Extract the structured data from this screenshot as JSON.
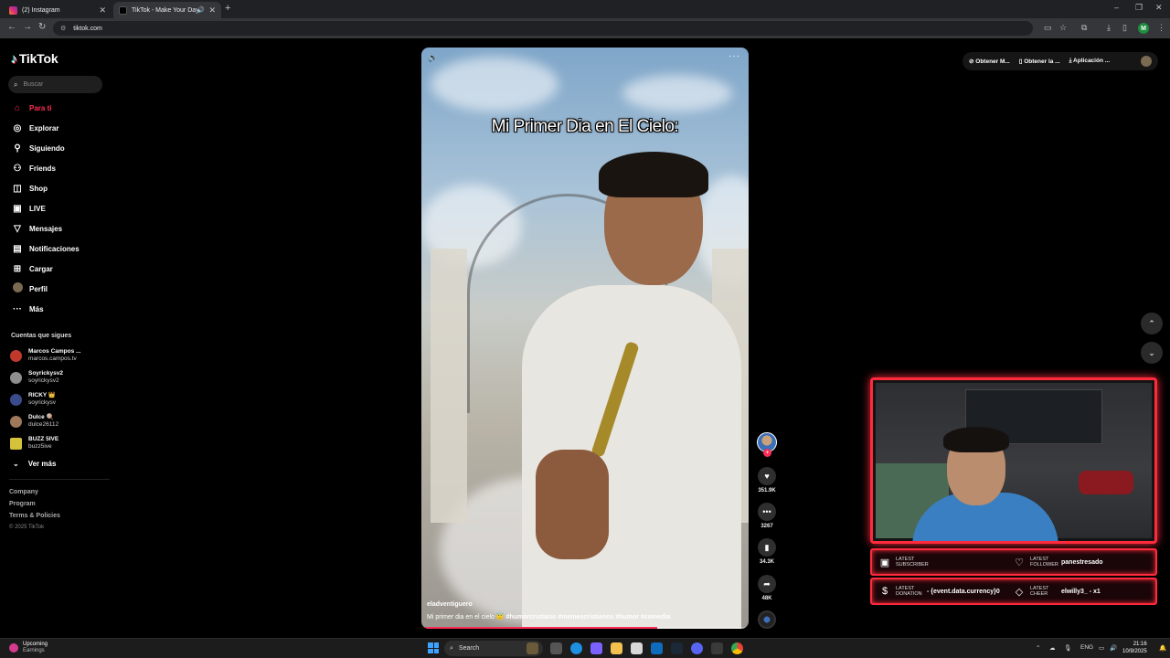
{
  "browser": {
    "tabs": [
      {
        "title": "(2) Instagram"
      },
      {
        "title": "TikTok - Make Your Day"
      }
    ],
    "url": "tiktok.com"
  },
  "tiktok": {
    "logo": "TikTok",
    "search_placeholder": "Buscar",
    "nav": [
      {
        "label": "Para ti",
        "icon": "home-icon",
        "active": true
      },
      {
        "label": "Explorar",
        "icon": "compass-icon"
      },
      {
        "label": "Siguiendo",
        "icon": "person-follow-icon"
      },
      {
        "label": "Friends",
        "icon": "friends-icon"
      },
      {
        "label": "Shop",
        "icon": "shop-bag-icon"
      },
      {
        "label": "LIVE",
        "icon": "live-icon"
      },
      {
        "label": "Mensajes",
        "icon": "send-icon"
      },
      {
        "label": "Notificaciones",
        "icon": "notification-icon"
      },
      {
        "label": "Cargar",
        "icon": "upload-icon"
      },
      {
        "label": "Perfil",
        "icon": "profile-avatar-icon"
      },
      {
        "label": "Más",
        "icon": "more-icon"
      }
    ],
    "following_title": "Cuentas que sigues",
    "following": [
      {
        "name": "Marcos Campos ...",
        "handle": "marcos.campos.tv",
        "color": "#c0392b"
      },
      {
        "name": "Soyrickysv2",
        "handle": "soyrickysv2",
        "color": "#8e8e8e"
      },
      {
        "name": "RICKY 👑",
        "handle": "soyrickysv",
        "color": "#3c4b8c"
      },
      {
        "name": "Dulce 🍭",
        "handle": "dulce26112",
        "color": "#a0785a"
      },
      {
        "name": "BUZZ 5IVE",
        "handle": "buzz5ive",
        "color": "#d4c23a"
      }
    ],
    "see_more": "Ver más",
    "footer": [
      "Company",
      "Program",
      "Terms & Policies"
    ],
    "copyright": "© 2025 TikTok",
    "top_actions": [
      "Obtener M...",
      "Obtener la ...",
      "Aplicación ..."
    ],
    "video": {
      "title": "Mi Primer Dia en El Cielo:",
      "author": "eladventiguero",
      "caption": "Mi primer dia en el cielo 😇",
      "hashtags": "#humorcristiano #memescristianos #humor #comedia",
      "progress": 0.72
    },
    "stats": {
      "likes": "351.9K",
      "comments": "3267",
      "saves": "34.3K",
      "shares": "48K"
    }
  },
  "overlay": {
    "alerts": [
      {
        "label": "LATEST SUBSCRIBER",
        "value": ""
      },
      {
        "label": "LATEST FOLLOWER",
        "value": "panestresado"
      },
      {
        "label": "LATEST DONATION",
        "value": "- {event.data.currency}0"
      },
      {
        "label": "LATEST CHEER",
        "value": "elwilly3_ - x1"
      }
    ]
  },
  "taskbar": {
    "weather_title": "Upcoming",
    "weather_sub": "Earnings",
    "search": "Search",
    "lang": "ENG",
    "time": "21:16",
    "date": "10/9/2025"
  }
}
